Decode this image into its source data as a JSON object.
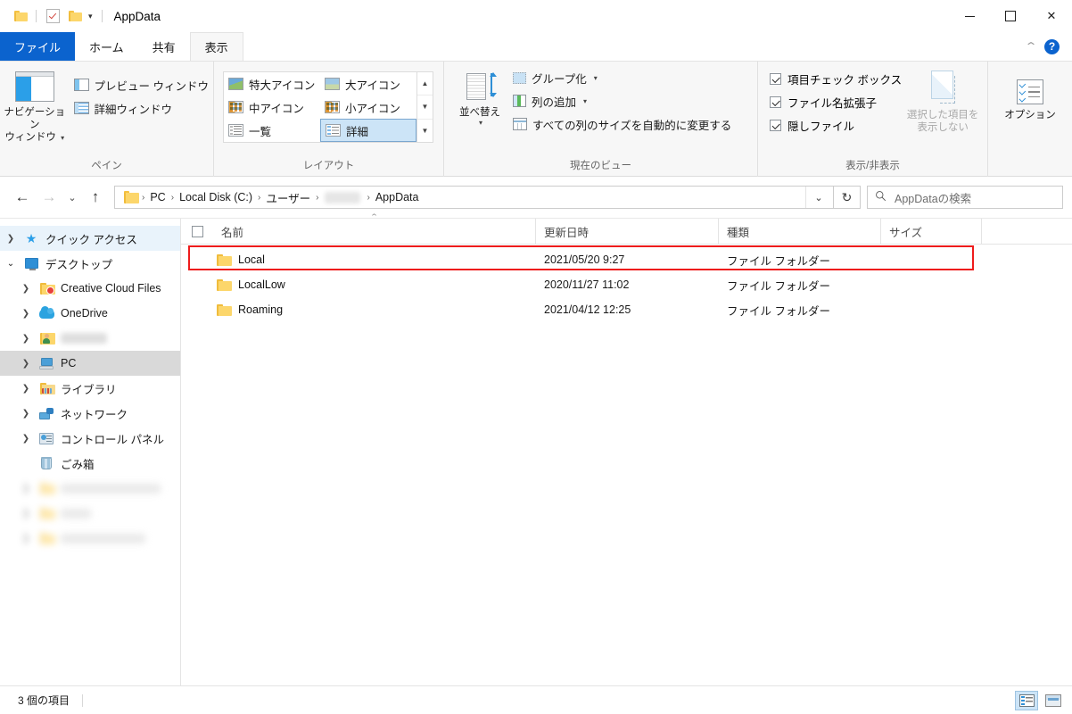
{
  "titlebar": {
    "quick_access": {
      "folder_icon": "folder-icon",
      "properties_icon": "properties-checkbox-icon",
      "new_folder_icon": "new-folder-icon",
      "customize_caret": "▾"
    },
    "title": "AppData",
    "minimize": "—",
    "maximize": "□",
    "close": "✕"
  },
  "tabs": [
    {
      "label": "ファイル",
      "state": "file"
    },
    {
      "label": "ホーム",
      "state": "normal"
    },
    {
      "label": "共有",
      "state": "normal"
    },
    {
      "label": "表示",
      "state": "active"
    }
  ],
  "ribbon": {
    "collapse_caret": "⌃",
    "help": "?",
    "groups": [
      {
        "title": "ペイン",
        "big_button": {
          "label_line1": "ナビゲーション",
          "label_line2": "ウィンドウ",
          "caret": "▾"
        },
        "items": [
          {
            "label": "プレビュー ウィンドウ"
          },
          {
            "label": "詳細ウィンドウ"
          }
        ]
      },
      {
        "title": "レイアウト",
        "cells": [
          {
            "label": "特大アイコン",
            "selected": false
          },
          {
            "label": "大アイコン",
            "selected": false
          },
          {
            "label": "中アイコン",
            "selected": false
          },
          {
            "label": "小アイコン",
            "selected": false
          },
          {
            "label": "一覧",
            "selected": false
          },
          {
            "label": "詳細",
            "selected": true
          }
        ],
        "scroll_up": "▲",
        "scroll_down": "▼",
        "scroll_more": "▼"
      },
      {
        "title": "現在のビュー",
        "big_button": {
          "label_line1": "並べ替え",
          "caret": "▾"
        },
        "items": [
          {
            "label": "グループ化",
            "has_caret": true
          },
          {
            "label": "列の追加",
            "has_caret": true
          },
          {
            "label": "すべての列のサイズを自動的に変更する",
            "has_caret": false
          }
        ]
      },
      {
        "title": "表示/非表示",
        "checkboxes": [
          {
            "label": "項目チェック ボックス",
            "checked": true
          },
          {
            "label": "ファイル名拡張子",
            "checked": true
          },
          {
            "label": "隠しファイル",
            "checked": true
          }
        ],
        "big_button": {
          "label_line1": "選択した項目を",
          "label_line2": "表示しない",
          "disabled": true
        }
      },
      {
        "title": "",
        "big_button": {
          "label_line1": "オプション"
        }
      }
    ]
  },
  "addressbar": {
    "back": "←",
    "forward": "→",
    "recent_caret": "⌄",
    "up": "↑",
    "breadcrumb_icon": "folder-icon",
    "breadcrumbs": [
      {
        "label": "PC",
        "redacted": false
      },
      {
        "label": "Local Disk (C:)",
        "redacted": false
      },
      {
        "label": "ユーザー",
        "redacted": false
      },
      {
        "label": "",
        "redacted": true
      },
      {
        "label": "AppData",
        "redacted": false
      }
    ],
    "separator": "›",
    "dropdown_caret": "⌄",
    "refresh": "↻",
    "search_placeholder": "AppDataの検索",
    "search_value": ""
  },
  "sidebar": {
    "items": [
      {
        "label": "クイック アクセス",
        "icon": "star-icon",
        "chevron": "collapsed",
        "indent": 0,
        "state": "quick"
      },
      {
        "label": "デスクトップ",
        "icon": "desktop-icon",
        "chevron": "expanded",
        "indent": 0,
        "state": "normal"
      },
      {
        "label": "Creative Cloud Files",
        "icon": "creative-cloud-folder-icon",
        "chevron": "collapsed",
        "indent": 1,
        "state": "normal"
      },
      {
        "label": "OneDrive",
        "icon": "onedrive-cloud-icon",
        "chevron": "collapsed",
        "indent": 1,
        "state": "normal"
      },
      {
        "label": "",
        "icon": "user-folder-icon",
        "chevron": "collapsed",
        "indent": 1,
        "state": "redacted"
      },
      {
        "label": "PC",
        "icon": "pc-icon",
        "chevron": "collapsed",
        "indent": 1,
        "state": "selected"
      },
      {
        "label": "ライブラリ",
        "icon": "library-folder-icon",
        "chevron": "collapsed",
        "indent": 1,
        "state": "normal"
      },
      {
        "label": "ネットワーク",
        "icon": "network-icon",
        "chevron": "collapsed",
        "indent": 1,
        "state": "normal"
      },
      {
        "label": "コントロール パネル",
        "icon": "control-panel-icon",
        "chevron": "collapsed",
        "indent": 1,
        "state": "normal"
      },
      {
        "label": "ごみ箱",
        "icon": "recycle-bin-icon",
        "chevron": "none",
        "indent": 1,
        "state": "normal"
      }
    ],
    "blurred_rows": 3
  },
  "filelist": {
    "columns": [
      {
        "label": "名前",
        "sorted": "asc"
      },
      {
        "label": "更新日時",
        "sorted": "none"
      },
      {
        "label": "種類",
        "sorted": "none"
      },
      {
        "label": "サイズ",
        "sorted": "none"
      }
    ],
    "sort_caret": "⌃",
    "rows": [
      {
        "name": "Local",
        "modified": "2021/05/20 9:27",
        "type": "ファイル フォルダー",
        "size": "",
        "highlighted": true
      },
      {
        "name": "LocalLow",
        "modified": "2020/11/27 11:02",
        "type": "ファイル フォルダー",
        "size": "",
        "highlighted": false
      },
      {
        "name": "Roaming",
        "modified": "2021/04/12 12:25",
        "type": "ファイル フォルダー",
        "size": "",
        "highlighted": false
      }
    ]
  },
  "statusbar": {
    "item_count": "3 個の項目",
    "view_details_label": "詳細表示",
    "view_icons_label": "大アイコン表示"
  },
  "colors": {
    "accent": "#0b63ce",
    "highlight_red": "#ee1c1c",
    "selection_blue": "#cce4f7",
    "folder_yellow": "#fcd66b"
  }
}
